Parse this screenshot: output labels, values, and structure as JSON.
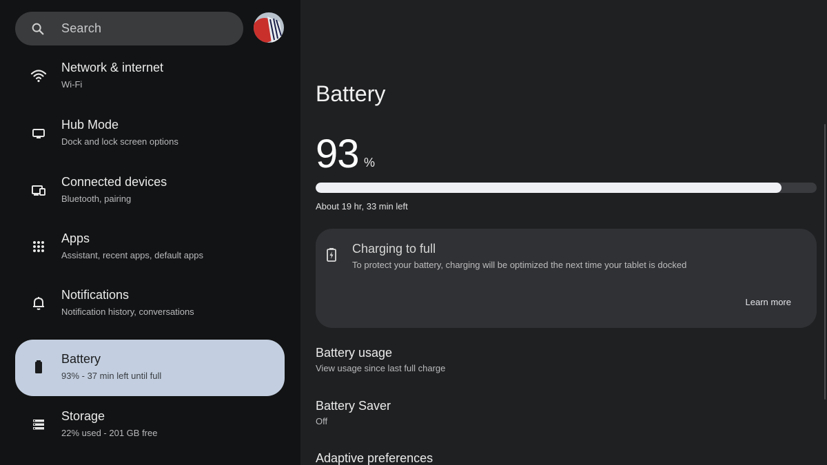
{
  "search": {
    "placeholder": "Search"
  },
  "sidebar": {
    "items": [
      {
        "title": "Network & internet",
        "subtitle": "Wi-Fi",
        "icon": "wifi-icon"
      },
      {
        "title": "Hub Mode",
        "subtitle": "Dock and lock screen options",
        "icon": "monitor-icon"
      },
      {
        "title": "Connected devices",
        "subtitle": "Bluetooth, pairing",
        "icon": "devices-icon"
      },
      {
        "title": "Apps",
        "subtitle": "Assistant, recent apps, default apps",
        "icon": "apps-grid-icon"
      },
      {
        "title": "Notifications",
        "subtitle": "Notification history, conversations",
        "icon": "bell-icon"
      },
      {
        "title": "Battery",
        "subtitle": "93% - 37 min left until full",
        "icon": "battery-icon",
        "active": true
      },
      {
        "title": "Storage",
        "subtitle": "22% used - 201 GB free",
        "icon": "storage-icon"
      }
    ]
  },
  "main": {
    "title": "Battery",
    "level": "93",
    "level_unit": "%",
    "level_fraction": 0.93,
    "time_left": "About 19 hr, 33 min left",
    "card": {
      "title": "Charging to full",
      "text": "To protect your battery, charging will be optimized the next time your tablet is docked",
      "action": "Learn more",
      "icon": "battery-charging-icon"
    },
    "prefs": [
      {
        "title": "Battery usage",
        "subtitle": "View usage since last full charge"
      },
      {
        "title": "Battery Saver",
        "subtitle": "Off"
      },
      {
        "title": "Adaptive preferences",
        "subtitle": ""
      }
    ]
  },
  "colors": {
    "sidebar_bg": "#121314",
    "main_bg": "#1f2022",
    "active_item": "#c3cfe0",
    "card_bg": "#303134"
  }
}
